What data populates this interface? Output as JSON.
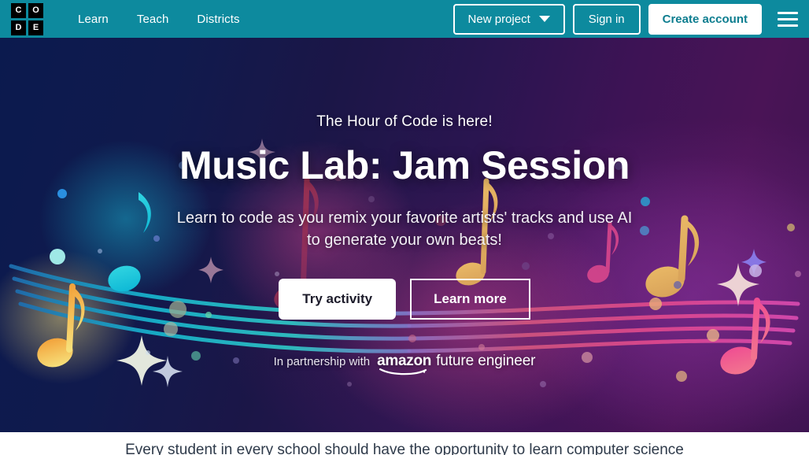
{
  "header": {
    "logo_letters": [
      "C",
      "O",
      "D",
      "E"
    ],
    "logo_name": "code-dot-org-logo",
    "nav": [
      {
        "label": "Learn"
      },
      {
        "label": "Teach"
      },
      {
        "label": "Districts"
      }
    ],
    "new_project_label": "New project",
    "sign_in_label": "Sign in",
    "create_account_label": "Create account",
    "menu_icon": "hamburger-menu-icon",
    "background_color": "#0d8a9e"
  },
  "hero": {
    "eyebrow": "The Hour of Code is here!",
    "title": "Music Lab: Jam Session",
    "subtitle": "Learn to code as you remix your favorite artists' tracks and use AI to generate your own beats!",
    "primary_cta": "Try activity",
    "secondary_cta": "Learn more",
    "partnership_prefix": "In partnership with",
    "partner_brand": "amazon",
    "partner_program": "future engineer",
    "gradient_start": "#0b1a4e",
    "gradient_end": "#4a1456"
  },
  "below_fold": {
    "text": "Every student in every school should have the opportunity to learn computer science"
  }
}
